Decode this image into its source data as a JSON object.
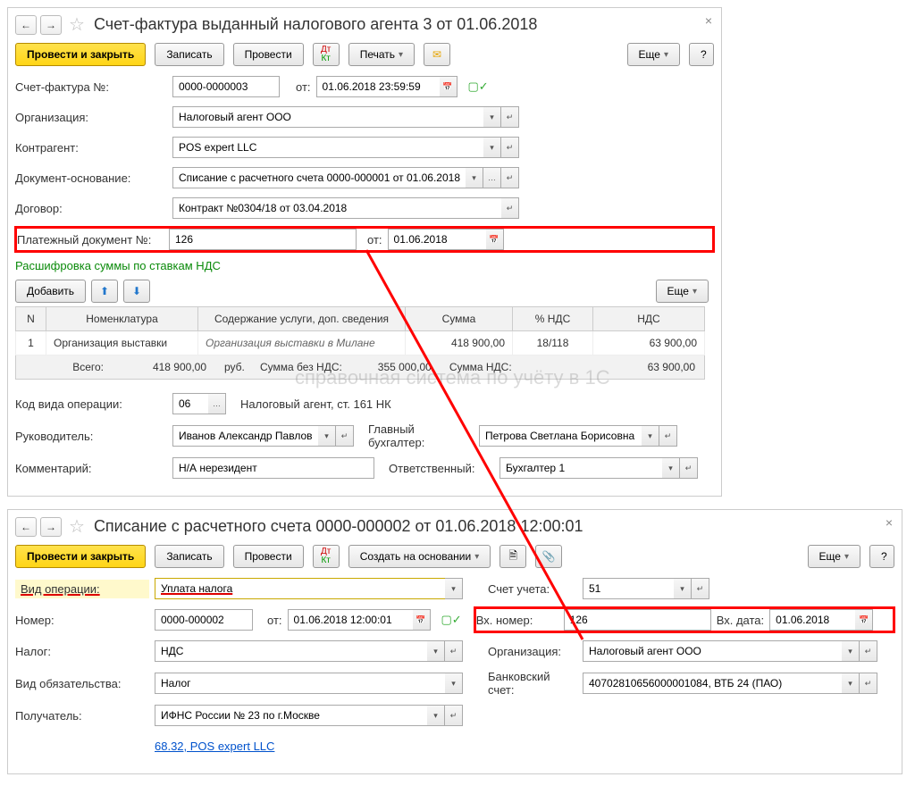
{
  "win1": {
    "title": "Счет-фактура выданный налогового агента 3 от 01.06.2018",
    "toolbar": {
      "post_close": "Провести и закрыть",
      "save": "Записать",
      "post": "Провести",
      "print": "Печать",
      "more": "Еще",
      "help": "?"
    },
    "num_label": "Счет-фактура №:",
    "num": "0000-0000003",
    "from": "от:",
    "date": "01.06.2018 23:59:59",
    "org_label": "Организация:",
    "org": "Налоговый агент ООО",
    "contractor_label": "Контрагент:",
    "contractor": "POS expert LLC",
    "basis_label": "Документ-основание:",
    "basis": "Списание с расчетного счета 0000-000001 от 01.06.2018",
    "contract_label": "Договор:",
    "contract": "Контракт №0304/18 от 03.04.2018",
    "paydoc_label": "Платежный документ №:",
    "paydoc_num": "126",
    "paydoc_date": "01.06.2018",
    "vat_link": "Расшифровка суммы по ставкам НДС",
    "add": "Добавить",
    "more2": "Еще",
    "grid": {
      "cols": [
        "N",
        "Номенклатура",
        "Содержание услуги, доп. сведения",
        "Сумма",
        "% НДС",
        "НДС"
      ],
      "row": {
        "n": "1",
        "nom": "Организация выставки",
        "desc": "Организация выставки в Милане",
        "sum": "418 900,00",
        "rate": "18/118",
        "vat": "63 900,00"
      }
    },
    "totals": {
      "total_label": "Всего:",
      "total": "418 900,00",
      "rub": "руб.",
      "novat_label": "Сумма без НДС:",
      "novat": "355 000,00",
      "vat_label": "Сумма НДС:",
      "vat": "63 900,00"
    },
    "opcode_label": "Код вида операции:",
    "opcode": "06",
    "opcode_desc": "Налоговый агент, ст. 161 НК",
    "head_label": "Руководитель:",
    "head": "Иванов Александр Павлович",
    "accountant_label": "Главный бухгалтер:",
    "accountant": "Петрова Светлана Борисовна",
    "comment_label": "Комментарий:",
    "comment": "Н/А нерезидент",
    "responsible_label": "Ответственный:",
    "responsible": "Бухгалтер 1"
  },
  "win2": {
    "title": "Списание с расчетного счета 0000-000002 от 01.06.2018 12:00:01",
    "toolbar": {
      "post_close": "Провести и закрыть",
      "save": "Записать",
      "post": "Провести",
      "create_from": "Создать на основании",
      "more": "Еще",
      "help": "?"
    },
    "optype_label": "Вид операции:",
    "optype": "Уплата налога",
    "acct_label": "Счет учета:",
    "acct": "51",
    "num_label": "Номер:",
    "num": "0000-000002",
    "from": "от:",
    "date": "01.06.2018 12:00:01",
    "innum_label": "Вх. номер:",
    "innum": "126",
    "indate_label": "Вх. дата:",
    "indate": "01.06.2018",
    "tax_label": "Налог:",
    "tax": "НДС",
    "org_label": "Организация:",
    "org": "Налоговый агент ООО",
    "liab_label": "Вид обязательства:",
    "liab": "Налог",
    "bank_label": "Банковский счет:",
    "bank": "40702810656000001084, ВТБ 24 (ПАО)",
    "payee_label": "Получатель:",
    "payee": "ИФНС России № 23 по г.Москве",
    "link": "68.32, POS expert LLC"
  },
  "watermark": "справочная система по учёту в 1С"
}
